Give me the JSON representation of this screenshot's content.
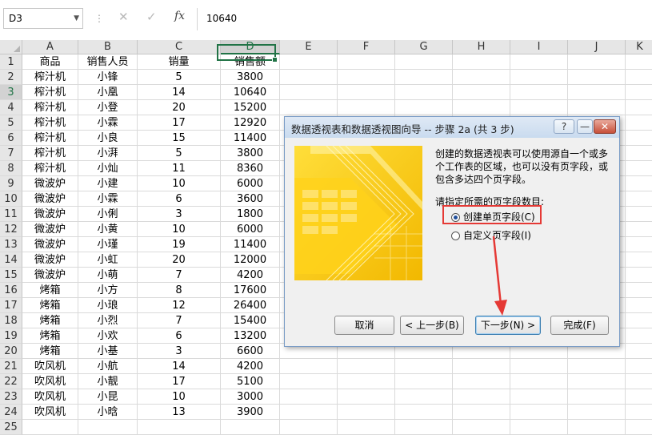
{
  "formula_bar": {
    "name_box": "D3",
    "cancel_icon": "✕",
    "enter_icon": "✓",
    "fx_label": "fx",
    "content": "10640"
  },
  "columns": [
    "A",
    "B",
    "C",
    "D",
    "E",
    "F",
    "G",
    "H",
    "I",
    "J",
    "K"
  ],
  "selected_column": "D",
  "selected_row": "3",
  "rows": [
    {
      "n": "1",
      "a": "商品",
      "b": "销售人员",
      "c": "销量",
      "d": "销售额"
    },
    {
      "n": "2",
      "a": "榨汁机",
      "b": "小锋",
      "c": "5",
      "d": "3800"
    },
    {
      "n": "3",
      "a": "榨汁机",
      "b": "小凰",
      "c": "14",
      "d": "10640"
    },
    {
      "n": "4",
      "a": "榨汁机",
      "b": "小登",
      "c": "20",
      "d": "15200"
    },
    {
      "n": "5",
      "a": "榨汁机",
      "b": "小霖",
      "c": "17",
      "d": "12920"
    },
    {
      "n": "6",
      "a": "榨汁机",
      "b": "小良",
      "c": "15",
      "d": "11400"
    },
    {
      "n": "7",
      "a": "榨汁机",
      "b": "小湃",
      "c": "5",
      "d": "3800"
    },
    {
      "n": "8",
      "a": "榨汁机",
      "b": "小灿",
      "c": "11",
      "d": "8360"
    },
    {
      "n": "9",
      "a": "微波炉",
      "b": "小建",
      "c": "10",
      "d": "6000"
    },
    {
      "n": "10",
      "a": "微波炉",
      "b": "小霖",
      "c": "6",
      "d": "3600"
    },
    {
      "n": "11",
      "a": "微波炉",
      "b": "小俐",
      "c": "3",
      "d": "1800"
    },
    {
      "n": "12",
      "a": "微波炉",
      "b": "小黄",
      "c": "10",
      "d": "6000"
    },
    {
      "n": "13",
      "a": "微波炉",
      "b": "小瑾",
      "c": "19",
      "d": "11400"
    },
    {
      "n": "14",
      "a": "微波炉",
      "b": "小虹",
      "c": "20",
      "d": "12000"
    },
    {
      "n": "15",
      "a": "微波炉",
      "b": "小萌",
      "c": "7",
      "d": "4200"
    },
    {
      "n": "16",
      "a": "烤箱",
      "b": "小方",
      "c": "8",
      "d": "17600"
    },
    {
      "n": "17",
      "a": "烤箱",
      "b": "小琅",
      "c": "12",
      "d": "26400"
    },
    {
      "n": "18",
      "a": "烤箱",
      "b": "小烈",
      "c": "7",
      "d": "15400"
    },
    {
      "n": "19",
      "a": "烤箱",
      "b": "小欢",
      "c": "6",
      "d": "13200"
    },
    {
      "n": "20",
      "a": "烤箱",
      "b": "小基",
      "c": "3",
      "d": "6600"
    },
    {
      "n": "21",
      "a": "吹风机",
      "b": "小航",
      "c": "14",
      "d": "4200"
    },
    {
      "n": "22",
      "a": "吹风机",
      "b": "小靓",
      "c": "17",
      "d": "5100"
    },
    {
      "n": "23",
      "a": "吹风机",
      "b": "小昆",
      "c": "10",
      "d": "3000"
    },
    {
      "n": "24",
      "a": "吹风机",
      "b": "小晗",
      "c": "13",
      "d": "3900"
    },
    {
      "n": "25",
      "a": "",
      "b": "",
      "c": "",
      "d": ""
    }
  ],
  "dialog": {
    "title": "数据透视表和数据透视图向导 -- 步骤 2a (共 3 步)",
    "help_label": "?",
    "minimize_label": "—",
    "close_label": "✕",
    "description": "创建的数据透视表可以使用源自一个或多个工作表的区域，也可以没有页字段，或包含多达四个页字段。",
    "prompt": "请指定所需的页字段数目:",
    "options": [
      {
        "label": "创建单页字段(C)",
        "selected": true
      },
      {
        "label": "自定义页字段(I)",
        "selected": false
      }
    ],
    "buttons": {
      "cancel": "取消",
      "back": "< 上一步(B)",
      "next": "下一步(N) >",
      "finish": "完成(F)"
    }
  },
  "colors": {
    "excel_green": "#217346",
    "highlight_red": "#e53935",
    "art_yellow": "#f5c400"
  }
}
